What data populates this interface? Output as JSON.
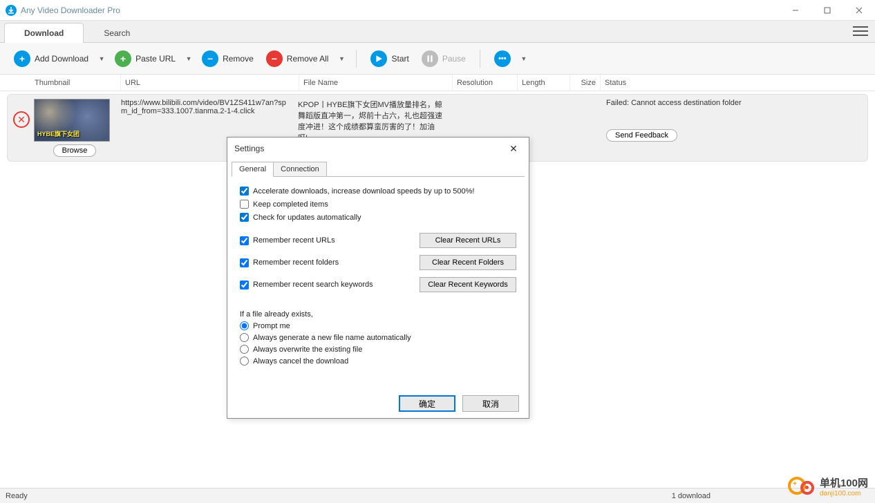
{
  "app": {
    "title": "Any Video Downloader Pro"
  },
  "tabs": {
    "download": "Download",
    "search": "Search"
  },
  "toolbar": {
    "add": "Add Download",
    "paste": "Paste URL",
    "remove": "Remove",
    "remove_all": "Remove All",
    "start": "Start",
    "pause": "Pause"
  },
  "columns": {
    "thumbnail": "Thumbnail",
    "url": "URL",
    "filename": "File Name",
    "resolution": "Resolution",
    "length": "Length",
    "size": "Size",
    "status": "Status"
  },
  "row": {
    "thumb_overlay": "HYBE旗下女团",
    "url": "https://www.bilibili.com/video/BV1ZS411w7an?spm_id_from=333.1007.tianma.2-1-4.click",
    "filename": "KPOP丨HYBE旗下女团MV播放量排名，鲸舞蹈版直冲第一，烬前十占六，礼也超强速度冲进！这个成绩都算蛮厉害的了！加油呀!",
    "status": "Failed: Cannot access destination folder",
    "browse": "Browse",
    "feedback": "Send Feedback"
  },
  "settings": {
    "title": "Settings",
    "tab_general": "General",
    "tab_connection": "Connection",
    "accelerate": "Accelerate downloads, increase download speeds by up to 500%!",
    "keep_completed": "Keep completed items",
    "check_updates": "Check for updates automatically",
    "remember_urls": "Remember recent URLs",
    "remember_folders": "Remember recent folders",
    "remember_keywords": "Remember recent search keywords",
    "clear_urls": "Clear Recent URLs",
    "clear_folders": "Clear Recent Folders",
    "clear_keywords": "Clear Recent Keywords",
    "exists_label": "If a file already exists,",
    "radio_prompt": "Prompt me",
    "radio_newname": "Always generate a new file name automatically",
    "radio_overwrite": "Always overwrite the existing file",
    "radio_cancel": "Always cancel the download",
    "ok": "确定",
    "cancel": "取消"
  },
  "status": {
    "ready": "Ready",
    "count": "1 download"
  },
  "watermark": {
    "name": "单机100网",
    "url": "danji100.com"
  }
}
